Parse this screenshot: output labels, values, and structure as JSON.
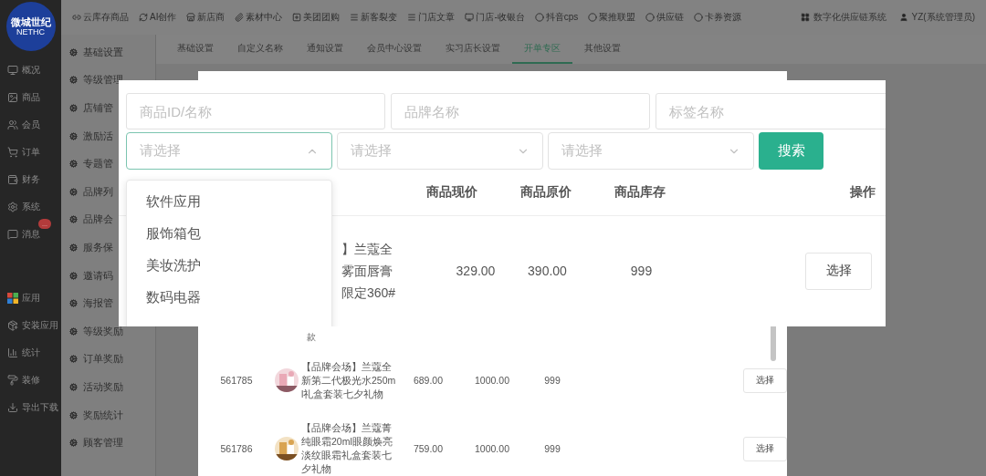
{
  "logo": {
    "text": "微城世纪",
    "subtext": "NETHC"
  },
  "sidebar": {
    "items": [
      {
        "label": "概况"
      },
      {
        "label": "商品"
      },
      {
        "label": "会员"
      },
      {
        "label": "订单"
      },
      {
        "label": "财务"
      },
      {
        "label": "系统"
      },
      {
        "label": "消息",
        "badge": "..."
      },
      {
        "label": "应用"
      },
      {
        "label": "安装应用"
      },
      {
        "label": "统计"
      },
      {
        "label": "装修"
      },
      {
        "label": "导出下载"
      }
    ]
  },
  "top_nav": {
    "items": [
      "云库存商品",
      "AI创作",
      "新店商",
      "素材中心",
      "美团团购",
      "新客裂变",
      "门店文章",
      "门店-收银台",
      "抖音cps",
      "聚推联盟",
      "供应链",
      "卡券资源"
    ],
    "system_link": "数字化供应链系统",
    "user": "YZ(系统管理员)"
  },
  "sub_nav": {
    "items": [
      "基础设置",
      "等级管理",
      "店铺管",
      "激励活",
      "专题管",
      "品牌列",
      "品牌会",
      "服务保",
      "邀请码",
      "海报管",
      "等级奖励",
      "订单奖励",
      "活动奖励",
      "奖励统计",
      "顾客管理"
    ]
  },
  "tabs": [
    {
      "label": "基础设置",
      "selected": false
    },
    {
      "label": "自定义名称",
      "selected": false
    },
    {
      "label": "通知设置",
      "selected": false
    },
    {
      "label": "会员中心设置",
      "selected": false
    },
    {
      "label": "实习店长设置",
      "selected": false
    },
    {
      "label": "开单专区",
      "selected": true
    },
    {
      "label": "其他设置",
      "selected": false
    }
  ],
  "back_dialog": {
    "cut_text": "款",
    "rows": [
      {
        "id": "561785",
        "name": "【品牌会场】兰蔻全新第二代极光水250ml礼盒套装七夕礼物",
        "price": "689.00",
        "original_price": "1000.00",
        "stock": "999",
        "action": "选择"
      },
      {
        "id": "561786",
        "name": "【品牌会场】兰蔻菁纯眼霜20ml眼颜焕亮淡纹眼霜礼盒套装七夕礼物",
        "price": "759.00",
        "original_price": "1000.00",
        "stock": "999",
        "action": "选择"
      }
    ]
  },
  "modal": {
    "fields": [
      {
        "placeholder": "商品ID/名称"
      },
      {
        "placeholder": "品牌名称"
      },
      {
        "placeholder": "标签名称"
      }
    ],
    "selects": [
      {
        "placeholder": "请选择",
        "expanded": true
      },
      {
        "placeholder": "请选择",
        "expanded": false
      },
      {
        "placeholder": "请选择",
        "expanded": false
      }
    ],
    "search_button": "搜索",
    "dropdown": {
      "options": [
        "软件应用",
        "服饰箱包",
        "美妆洗护",
        "数码电器"
      ]
    },
    "table": {
      "columns": [
        "商品现价",
        "商品原价",
        "商品库存",
        "操作"
      ],
      "rows": [
        {
          "name_lines": [
            "】兰蔻全",
            "雾面唇膏",
            "限定360#"
          ],
          "price": "329.00",
          "original_price": "390.00",
          "stock": "999",
          "action": "选择"
        }
      ]
    }
  }
}
